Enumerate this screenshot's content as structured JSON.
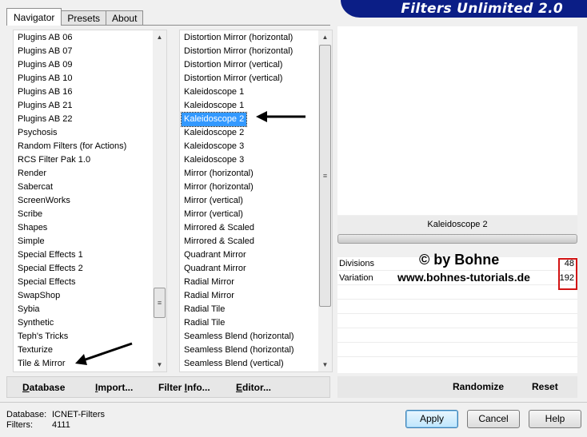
{
  "tabs": [
    {
      "label": "Navigator",
      "active": true
    },
    {
      "label": "Presets",
      "active": false
    },
    {
      "label": "About",
      "active": false
    }
  ],
  "banner": {
    "title": "Filters Unlimited 2.0",
    "color": "#0b1e86"
  },
  "categories": [
    "Plugins AB 06",
    "Plugins AB 07",
    "Plugins AB 09",
    "Plugins AB 10",
    "Plugins AB 16",
    "Plugins AB 21",
    "Plugins AB 22",
    "Psychosis",
    "Random Filters (for Actions)",
    "RCS Filter Pak 1.0",
    "Render",
    "Sabercat",
    "ScreenWorks",
    "Scribe",
    "Shapes",
    "Simple",
    "Special Effects 1",
    "Special Effects 2",
    "Special Effects",
    "SwapShop",
    "Sybia",
    "Synthetic",
    "Teph's Tricks",
    "Texturize",
    "Tile & Mirror"
  ],
  "selected_category": "Tile & Mirror",
  "filters": [
    "Distortion Mirror (horizontal)",
    "Distortion Mirror (horizontal)",
    "Distortion Mirror (vertical)",
    "Distortion Mirror (vertical)",
    "Kaleidoscope 1",
    "Kaleidoscope 1",
    "Kaleidoscope 2",
    "Kaleidoscope 2",
    "Kaleidoscope 3",
    "Kaleidoscope 3",
    "Mirror (horizontal)",
    "Mirror (horizontal)",
    "Mirror (vertical)",
    "Mirror (vertical)",
    "Mirrored & Scaled",
    "Mirrored & Scaled",
    "Quadrant Mirror",
    "Quadrant Mirror",
    "Radial Mirror",
    "Radial Mirror",
    "Radial Tile",
    "Radial Tile",
    "Seamless Blend (horizontal)",
    "Seamless Blend (horizontal)",
    "Seamless Blend (vertical)"
  ],
  "selected_filter_index": 6,
  "left_buttons": {
    "database": {
      "u": "D",
      "rest": "atabase"
    },
    "import": {
      "u": "I",
      "rest": "mport..."
    },
    "filter_info": {
      "pre": "Filter ",
      "u": "I",
      "rest": "nfo..."
    },
    "editor": {
      "u": "E",
      "rest": "ditor..."
    }
  },
  "filter_title": "Kaleidoscope 2",
  "params": [
    {
      "label": "Divisions",
      "value": "48"
    },
    {
      "label": "Variation",
      "value": "192"
    }
  ],
  "watermark": {
    "line1": "© by Bohne",
    "line2": "www.bohnes-tutorials.de"
  },
  "right_buttons": {
    "randomize": "Randomize",
    "reset": "Reset"
  },
  "status": {
    "database_label": "Database:",
    "database_value": "ICNET-Filters",
    "filters_label": "Filters:",
    "filters_value": "4111"
  },
  "dialog_buttons": {
    "apply": "Apply",
    "cancel": "Cancel",
    "help": "Help"
  },
  "colors": {
    "selection": "#3399ff",
    "highlight_box": "#d21414"
  }
}
